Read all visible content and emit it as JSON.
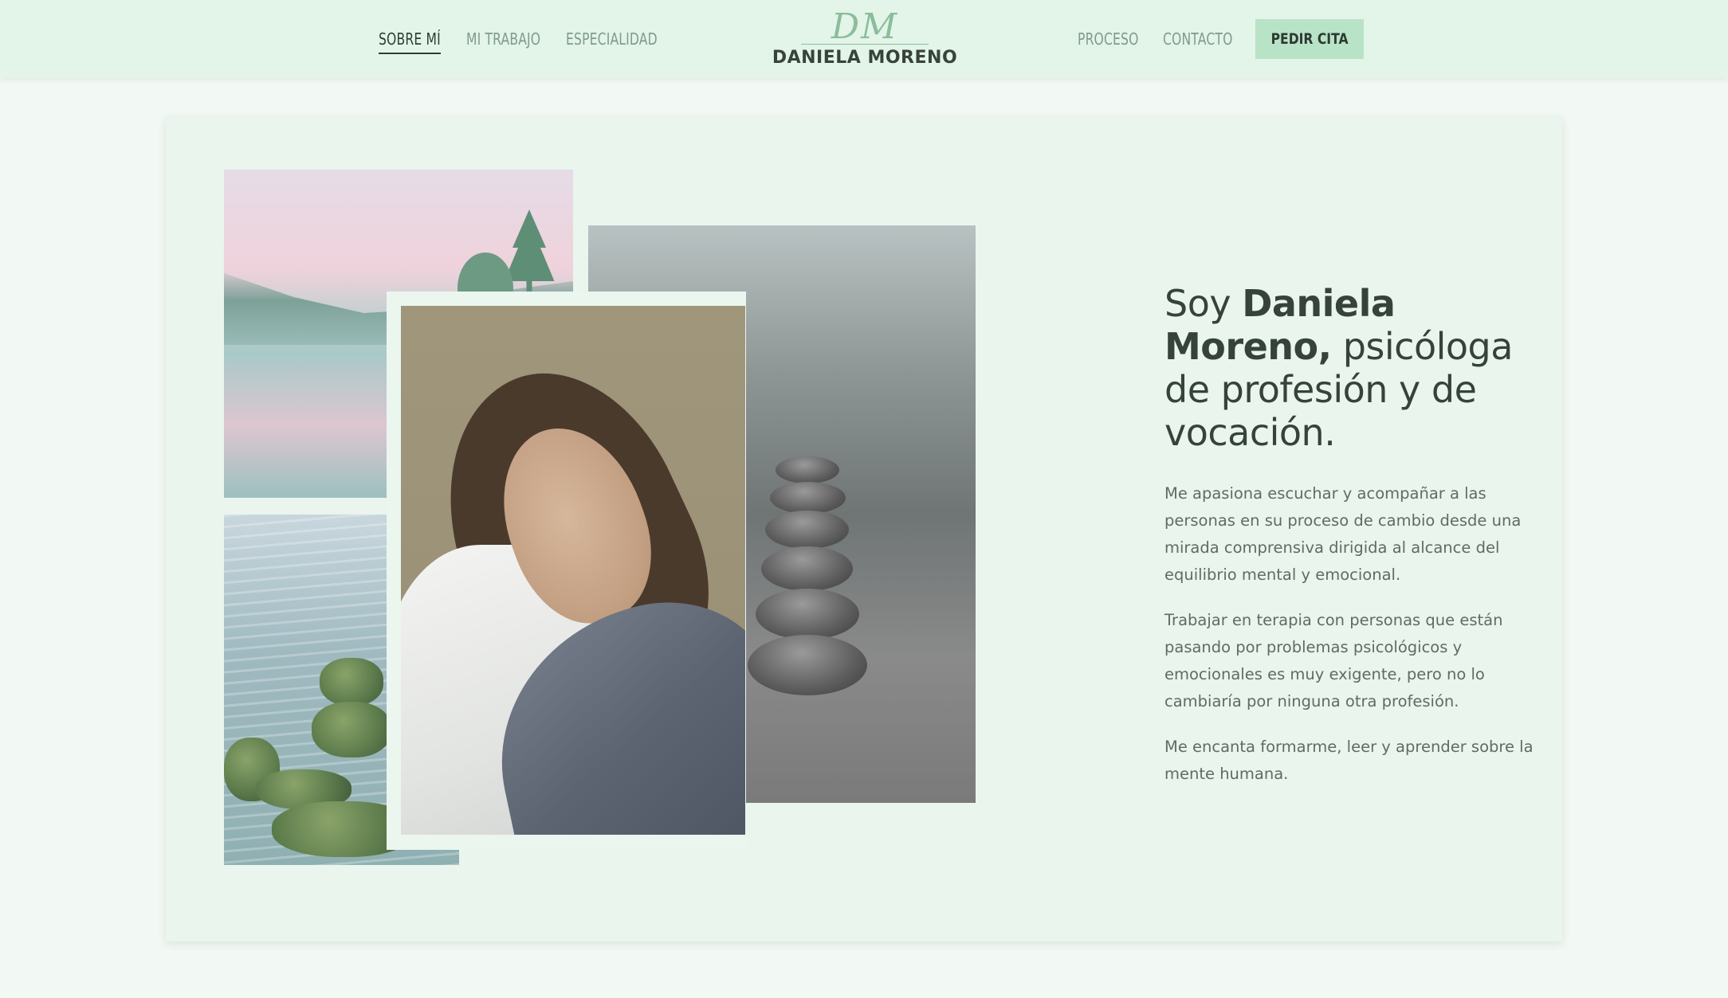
{
  "header": {
    "nav_left": [
      "SOBRE MÍ",
      "MI TRABAJO",
      "ESPECIALIDAD"
    ],
    "nav_right": [
      "PROCESO",
      "CONTACTO"
    ],
    "active_item": "SOBRE MÍ",
    "logo_monogram": "DM",
    "logo_name": "DANIELA MORENO",
    "cta_label": "PEDIR CITA"
  },
  "about": {
    "heading_prefix": "Soy ",
    "heading_name": "Daniela Moreno,",
    "heading_rest": " psicóloga de profesión y de vocación.",
    "paragraphs": [
      "Me apasiona escuchar y acompañar a las personas en su proceso de cambio desde una mirada comprensiva dirigida al alcance del equilibrio mental y emocional.",
      "Trabajar en terapia con personas que están pasando por problemas psicológicos y emocionales es muy exigente, pero no lo cambiaría por ninguna otra profesión.",
      "Me encanta formarme, leer y aprender sobre la mente humana."
    ]
  },
  "colors": {
    "header_bg": "#e3f4e8",
    "page_bg": "#f2f8f4",
    "card_bg": "#e9f5ed",
    "accent": "#b9e3c6",
    "logo_green": "#8bbd9a",
    "text_dark": "#35433a",
    "nav_muted": "#7e9c8a"
  }
}
